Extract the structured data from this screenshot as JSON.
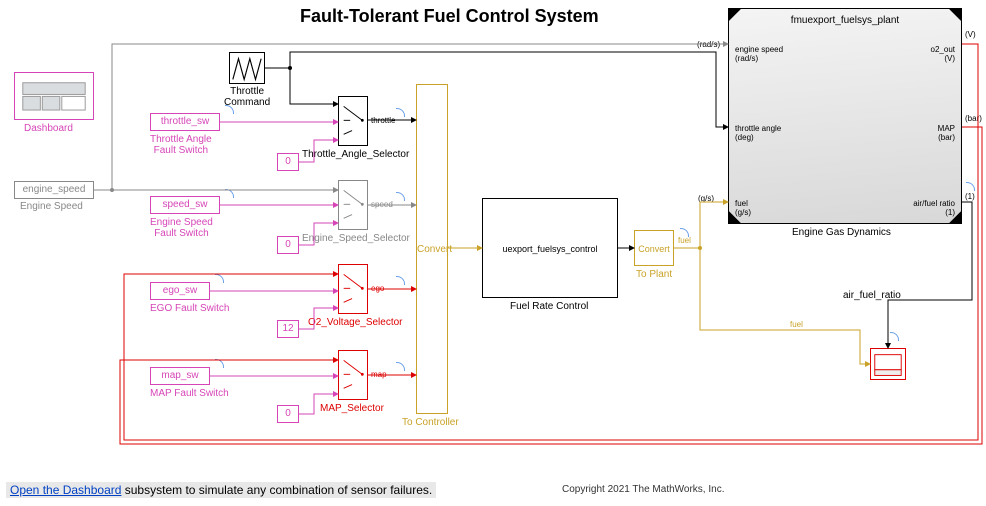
{
  "title": "Fault-Tolerant Fuel Control System",
  "dashboard": {
    "label": "Dashboard"
  },
  "inputs": {
    "engine_speed": {
      "block": "engine_speed",
      "label": "Engine Speed"
    },
    "throttle_sw": {
      "block": "throttle_sw",
      "label": "Throttle Angle\nFault Switch"
    },
    "speed_sw": {
      "block": "speed_sw",
      "label": "Engine Speed\nFault Switch"
    },
    "ego_sw": {
      "block": "ego_sw",
      "label": "EGO Fault Switch"
    },
    "map_sw": {
      "block": "map_sw",
      "label": "MAP Fault Switch"
    }
  },
  "consts": {
    "c0a": "0",
    "c0b": "0",
    "c12": "12",
    "c0c": "0"
  },
  "throttle_cmd": {
    "label": "Throttle\nCommand"
  },
  "selectors": {
    "throttle": {
      "label": "Throttle_Angle_Selector",
      "port": "throttle"
    },
    "speed": {
      "label": "Engine_Speed_Selector",
      "port": "speed"
    },
    "o2": {
      "label": "O2_Voltage_Selector",
      "port": "ego"
    },
    "map": {
      "label": "MAP_Selector",
      "port": "map"
    }
  },
  "to_controller": {
    "label": "To Controller",
    "text": "Convert"
  },
  "frc": {
    "label": "Fuel Rate Control",
    "text": "uexport_fuelsys_control"
  },
  "to_plant": {
    "label": "To Plant",
    "text": "Convert"
  },
  "plant": {
    "title": "fmuexport_fuelsys_plant",
    "label": "Engine Gas Dynamics",
    "ports_left": [
      {
        "name": "engine speed",
        "unit": "(rad/s)"
      },
      {
        "name": "throttle angle",
        "unit": "(deg)"
      },
      {
        "name": "fuel",
        "unit": "(g/s)"
      }
    ],
    "ports_right": [
      {
        "name": "o2_out",
        "unit": "(V)"
      },
      {
        "name": "MAP",
        "unit": "(bar)"
      },
      {
        "name": "air/fuel ratio",
        "unit": "(1)"
      }
    ],
    "ext_left": "(rad/s)",
    "ext_right": [
      "(V)",
      "(bar)",
      "(1)"
    ]
  },
  "signals": {
    "fuel": "fuel",
    "afr": "air_fuel_ratio",
    "gs": "(g/s)"
  },
  "footer": {
    "link": "Open the Dashboard",
    "rest": " subsystem to simulate any combination of sensor failures.",
    "copyright": "Copyright 2021 The MathWorks, Inc."
  }
}
